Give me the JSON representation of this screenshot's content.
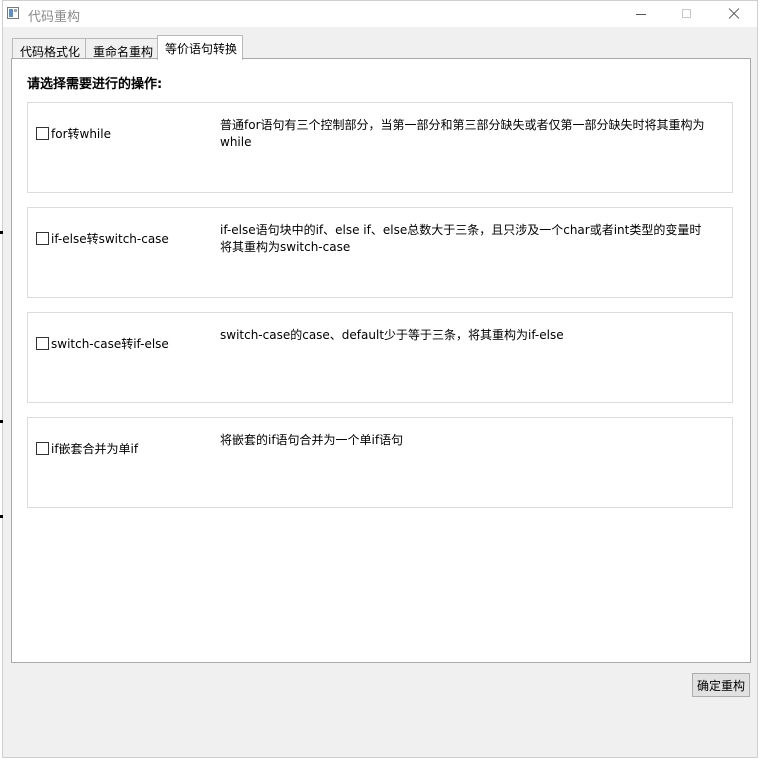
{
  "window": {
    "title": "代码重构"
  },
  "tabs": [
    {
      "label": "代码格式化",
      "active": false
    },
    {
      "label": "重命名重构",
      "active": false
    },
    {
      "label": "等价语句转换",
      "active": true
    }
  ],
  "panel": {
    "heading": "请选择需要进行的操作:",
    "options": [
      {
        "label": "for转while",
        "checked": false,
        "description": "普通for语句有三个控制部分，当第一部分和第三部分缺失或者仅第一部分缺失时将其重构为while"
      },
      {
        "label": "if-else转switch-case",
        "checked": false,
        "description": "if-else语句块中的if、else if、else总数大于三条，且只涉及一个char或者int类型的变量时将其重构为switch-case"
      },
      {
        "label": "switch-case转if-else",
        "checked": false,
        "description": "switch-case的case、default少于等于三条，将其重构为if-else"
      },
      {
        "label": "if嵌套合并为单if",
        "checked": false,
        "description": "将嵌套的if语句合并为一个单if语句"
      }
    ]
  },
  "footer": {
    "confirm_label": "确定重构"
  }
}
